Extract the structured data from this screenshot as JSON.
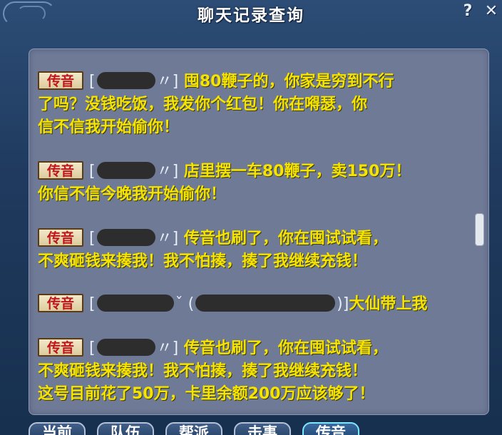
{
  "window": {
    "title": "聊天记录查询",
    "help_label": "?",
    "close_label": "✕"
  },
  "messages": [
    {
      "channel": "传音",
      "lines": [
        "囤80鞭子的，你家是穷到不行",
        "了吗？没钱吃饭，我发你个红包！你在嘚瑟，你",
        "信不信我开始偷你！"
      ]
    },
    {
      "channel": "传音",
      "lines": [
        "店里摆一车80鞭子，卖150万！",
        "你信不信今晚我开始偷你！"
      ]
    },
    {
      "channel": "传音",
      "lines": [
        "传音也刷了，你在囤试试看，",
        "不爽砸钱来揍我！我不怕揍，揍了我继续充钱！"
      ]
    },
    {
      "channel": "传音",
      "lines": [
        "大仙带上我"
      ]
    },
    {
      "channel": "传音",
      "lines": [
        "传音也刷了，你在囤试试看，",
        "不爽砸钱来揍我！我不怕揍，揍了我继续充钱！",
        "这号目前花了50万，卡里余额200万应该够了！"
      ]
    }
  ],
  "tabs": [
    "当前",
    "队伍",
    "帮派",
    "击事",
    "传音"
  ],
  "active_tab": "传音"
}
